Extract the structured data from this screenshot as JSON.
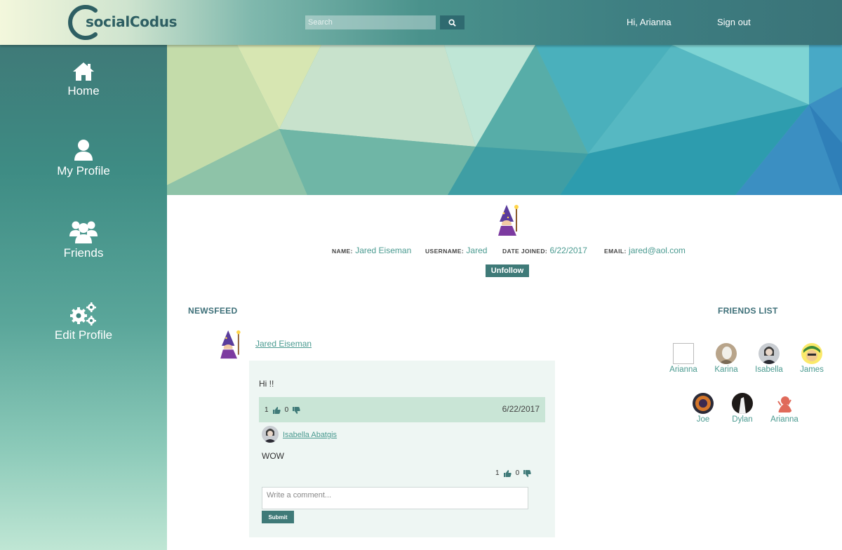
{
  "header": {
    "logo_text": "socialCodus",
    "search_placeholder": "Search",
    "greeting": "Hi, Arianna",
    "sign_out": "Sign out"
  },
  "sidebar": {
    "items": [
      {
        "label": "Home",
        "icon": "home-icon"
      },
      {
        "label": "My Profile",
        "icon": "user-icon"
      },
      {
        "label": "Friends",
        "icon": "users-icon"
      },
      {
        "label": "Edit Profile",
        "icon": "gears-icon"
      }
    ]
  },
  "profile": {
    "name_key": "NAME:",
    "name": "Jared Eiseman",
    "username_key": "USERNAME:",
    "username": "Jared",
    "joined_key": "DATE JOINED:",
    "joined": "6/22/2017",
    "email_key": "EMAIL:",
    "email": "jared@aol.com",
    "unfollow_label": "Unfollow"
  },
  "newsfeed": {
    "title": "NEWSFEED",
    "post": {
      "author": "Jared Eiseman",
      "text": "Hi !!",
      "likes": "1",
      "dislikes": "0",
      "date": "6/22/2017",
      "comment": {
        "author": "Isabella Abatgis",
        "text": "WOW",
        "likes": "1",
        "dislikes": "0"
      },
      "comment_placeholder": "Write a comment...",
      "submit_label": "Submit"
    }
  },
  "friends": {
    "title": "FRIENDS LIST",
    "list": [
      {
        "name": "Arianna"
      },
      {
        "name": "Karina"
      },
      {
        "name": "Isabella"
      },
      {
        "name": "James"
      },
      {
        "name": "Joe"
      },
      {
        "name": "Dylan"
      },
      {
        "name": "Arianna"
      }
    ]
  },
  "colors": {
    "accent": "#3f7a78",
    "link": "#4a9a90"
  }
}
